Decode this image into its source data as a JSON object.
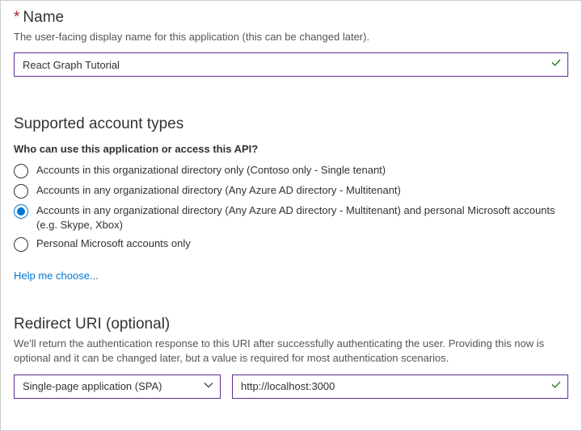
{
  "name": {
    "title": "Name",
    "desc": "The user-facing display name for this application (this can be changed later).",
    "value": "React Graph Tutorial"
  },
  "accountTypes": {
    "title": "Supported account types",
    "question": "Who can use this application or access this API?",
    "options": [
      "Accounts in this organizational directory only (Contoso only - Single tenant)",
      "Accounts in any organizational directory (Any Azure AD directory - Multitenant)",
      "Accounts in any organizational directory (Any Azure AD directory - Multitenant) and personal Microsoft accounts (e.g. Skype, Xbox)",
      "Personal Microsoft accounts only"
    ],
    "selectedIndex": 2,
    "helpLink": "Help me choose..."
  },
  "redirect": {
    "title": "Redirect URI (optional)",
    "desc": "We'll return the authentication response to this URI after successfully authenticating the user. Providing this now is optional and it can be changed later, but a value is required for most authentication scenarios.",
    "platform": "Single-page application (SPA)",
    "uri": "http://localhost:3000"
  }
}
